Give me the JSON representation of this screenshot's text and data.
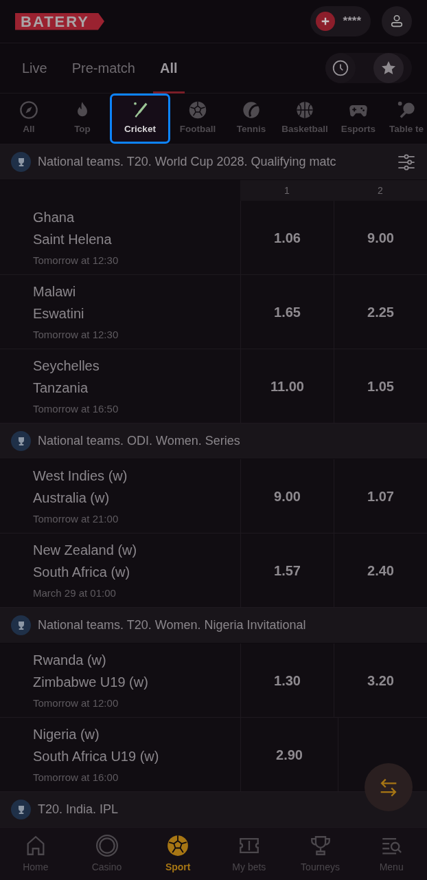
{
  "header": {
    "logo": "BATERY",
    "balance": "****"
  },
  "mode_tabs": [
    {
      "label": "Live",
      "selected": false
    },
    {
      "label": "Pre-match",
      "selected": false
    },
    {
      "label": "All",
      "selected": true
    }
  ],
  "sports": [
    {
      "label": "All",
      "kind": "compass",
      "selected": false
    },
    {
      "label": "Top",
      "kind": "fire",
      "selected": false
    },
    {
      "label": "Cricket",
      "kind": "cricket",
      "selected": true
    },
    {
      "label": "Football",
      "kind": "ball",
      "selected": false
    },
    {
      "label": "Tennis",
      "kind": "tennis",
      "selected": false
    },
    {
      "label": "Basketball",
      "kind": "basketball",
      "selected": false
    },
    {
      "label": "Esports",
      "kind": "gamepad",
      "selected": false
    },
    {
      "label": "Table te",
      "kind": "pingpong",
      "selected": false
    }
  ],
  "odds_columns": [
    "1",
    "2"
  ],
  "groups": [
    {
      "title": "National teams. T20. World Cup 2028. Qualifying matc",
      "filter": true,
      "events": [
        {
          "team_1": "Ghana",
          "team_2": "Saint Helena",
          "time": "Tomorrow at 12:30",
          "odds": [
            "1.06",
            "9.00"
          ]
        },
        {
          "team_1": "Malawi",
          "team_2": "Eswatini",
          "time": "Tomorrow at 12:30",
          "odds": [
            "1.65",
            "2.25"
          ]
        },
        {
          "team_1": "Seychelles",
          "team_2": "Tanzania",
          "time": "Tomorrow at 16:50",
          "odds": [
            "11.00",
            "1.05"
          ]
        }
      ]
    },
    {
      "title": "National teams. ODI. Women. Series",
      "events": [
        {
          "team_1": "West Indies (w)",
          "team_2": "Australia (w)",
          "time": "Tomorrow at 21:00",
          "odds": [
            "9.00",
            "1.07"
          ]
        },
        {
          "team_1": "New Zealand (w)",
          "team_2": "South Africa (w)",
          "time": "March 29 at 01:00",
          "odds": [
            "1.57",
            "2.40"
          ]
        }
      ]
    },
    {
      "title": "National teams. T20. Women. Nigeria Invitational",
      "events": [
        {
          "team_1": "Rwanda (w)",
          "team_2": "Zimbabwe U19 (w)",
          "time": "Tomorrow at 12:00",
          "odds": [
            "1.30",
            "3.20"
          ]
        },
        {
          "team_1": "Nigeria (w)",
          "team_2": "South Africa U19 (w)",
          "time": "Tomorrow at 16:00",
          "odds": [
            "2.90"
          ]
        }
      ]
    },
    {
      "title": "T20. India. IPL"
    }
  ],
  "bottom_nav": [
    {
      "label": "Home",
      "kind": "home",
      "selected": false
    },
    {
      "label": "Casino",
      "kind": "chip",
      "selected": false
    },
    {
      "label": "Sport",
      "kind": "ball",
      "selected": true
    },
    {
      "label": "My bets",
      "kind": "ticket",
      "selected": false
    },
    {
      "label": "Tourneys",
      "kind": "trophy",
      "selected": false
    },
    {
      "label": "Menu",
      "kind": "menu",
      "selected": false
    }
  ]
}
